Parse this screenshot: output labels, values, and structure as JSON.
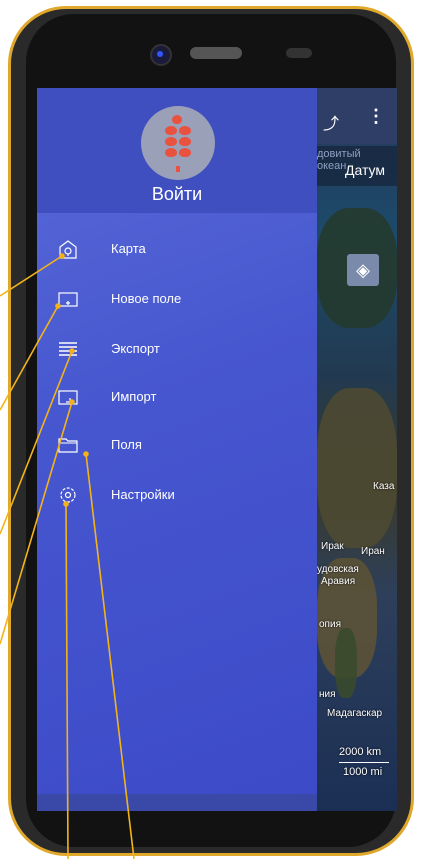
{
  "drawer": {
    "login_label": "Войти",
    "items": [
      {
        "label": "Карта",
        "icon": "map-pin-icon"
      },
      {
        "label": "Новое поле",
        "icon": "new-field-icon"
      },
      {
        "label": "Экспорт",
        "icon": "export-list-icon"
      },
      {
        "label": "Импорт",
        "icon": "import-icon"
      },
      {
        "label": "Поля",
        "icon": "folder-icon"
      },
      {
        "label": "Настройки",
        "icon": "gear-icon"
      }
    ]
  },
  "map": {
    "ocean_label_1": "довитый",
    "ocean_label_2": "океан",
    "datum_label": "Датум",
    "labels": [
      "Каза",
      "Ирак",
      "Иран",
      "удовская",
      "Аравия",
      "опия",
      "ния",
      "Мадагаскар"
    ],
    "scale_km": "2000 km",
    "scale_mi": "1000 mi"
  },
  "colors": {
    "drawer_bg": "#4757cf",
    "header_bg": "#3f4fbf",
    "logo_red": "#e8523e",
    "phone_trim": "#e0a82a",
    "callout_line": "#f2b31a"
  }
}
